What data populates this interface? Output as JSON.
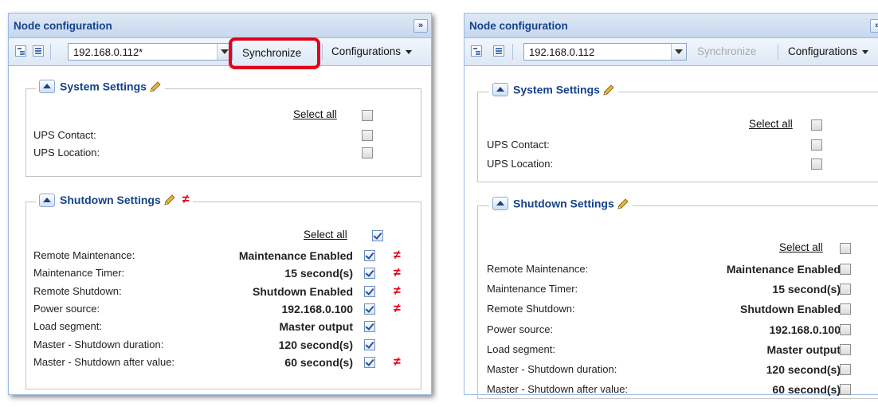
{
  "left": {
    "title": "Node configuration",
    "collapse_label": "»",
    "ip_value": "192.168.0.112*",
    "synchronize_label": "Synchronize",
    "configurations_label": "Configurations",
    "system_settings": {
      "title": "System Settings",
      "select_all_label": "Select all",
      "select_all_checked": false,
      "rows": [
        {
          "label": "UPS Contact:",
          "value": "",
          "checked": false,
          "diff": false
        },
        {
          "label": "UPS Location:",
          "value": "",
          "checked": false,
          "diff": false
        }
      ]
    },
    "shutdown_settings": {
      "title": "Shutdown Settings",
      "diff_marker": "≠",
      "select_all_label": "Select all",
      "select_all_checked": true,
      "rows": [
        {
          "label": "Remote Maintenance:",
          "value": "Maintenance Enabled",
          "checked": true,
          "diff": true
        },
        {
          "label": "Maintenance Timer:",
          "value": "15 second(s)",
          "checked": true,
          "diff": true
        },
        {
          "label": "Remote Shutdown:",
          "value": "Shutdown Enabled",
          "checked": true,
          "diff": true
        },
        {
          "label": "Power source:",
          "value": "192.168.0.100",
          "checked": true,
          "diff": true
        },
        {
          "label": "Load segment:",
          "value": "Master output",
          "checked": true,
          "diff": false
        },
        {
          "label": "Master - Shutdown duration:",
          "value": "120 second(s)",
          "checked": true,
          "diff": false
        },
        {
          "label": "Master - Shutdown after value:",
          "value": "60 second(s)",
          "checked": true,
          "diff": true
        }
      ]
    }
  },
  "right": {
    "title": "Node configuration",
    "collapse_label": "»",
    "ip_value": "192.168.0.112",
    "synchronize_label": "Synchronize",
    "configurations_label": "Configurations",
    "system_settings": {
      "title": "System Settings",
      "select_all_label": "Select all",
      "select_all_checked": false,
      "rows": [
        {
          "label": "UPS Contact:",
          "value": "",
          "checked": false,
          "diff": false
        },
        {
          "label": "UPS Location:",
          "value": "",
          "checked": false,
          "diff": false
        }
      ]
    },
    "shutdown_settings": {
      "title": "Shutdown Settings",
      "select_all_label": "Select all",
      "select_all_checked": false,
      "rows": [
        {
          "label": "Remote Maintenance:",
          "value": "Maintenance Enabled",
          "checked": false,
          "diff": false
        },
        {
          "label": "Maintenance Timer:",
          "value": "15 second(s)",
          "checked": false,
          "diff": false
        },
        {
          "label": "Remote Shutdown:",
          "value": "Shutdown Enabled",
          "checked": false,
          "diff": false
        },
        {
          "label": "Power source:",
          "value": "192.168.0.100",
          "checked": false,
          "diff": false
        },
        {
          "label": "Load segment:",
          "value": "Master output",
          "checked": false,
          "diff": false
        },
        {
          "label": "Master - Shutdown duration:",
          "value": "120 second(s)",
          "checked": false,
          "diff": false
        },
        {
          "label": "Master - Shutdown after value:",
          "value": "60 second(s)",
          "checked": false,
          "diff": false
        }
      ]
    }
  },
  "colors": {
    "accent": "#15428b",
    "highlight": "#e2001a",
    "diff": "#e2001a"
  }
}
